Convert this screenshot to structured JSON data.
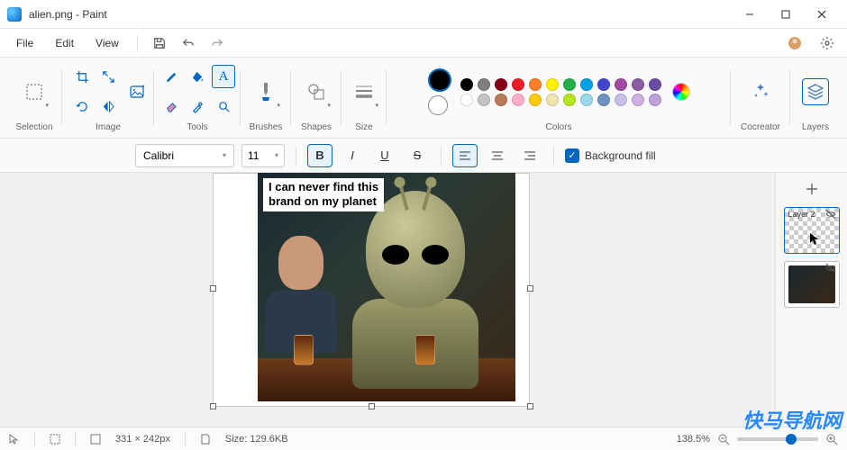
{
  "titlebar": {
    "title": "alien.png - Paint"
  },
  "menubar": {
    "file": "File",
    "edit": "Edit",
    "view": "View"
  },
  "ribbon": {
    "selection_label": "Selection",
    "image_label": "Image",
    "tools_label": "Tools",
    "brushes_label": "Brushes",
    "shapes_label": "Shapes",
    "size_label": "Size",
    "colors_label": "Colors",
    "cocreator_label": "Cocreator",
    "layers_label": "Layers",
    "palette_row1": [
      "#000000",
      "#7f7f7f",
      "#880015",
      "#ed1c24",
      "#ff7f27",
      "#fff200",
      "#22b14c",
      "#00a2e8",
      "#3f48cc",
      "#a349a4",
      "#8a5ca4",
      "#6a4ca4"
    ],
    "palette_row2": [
      "#ffffff",
      "#c3c3c3",
      "#b97a57",
      "#ffaec9",
      "#ffc90e",
      "#efe4b0",
      "#b5e61d",
      "#99d9ea",
      "#7092be",
      "#c8bfe7",
      "#d0b0e0",
      "#bfa0d8"
    ],
    "primary_color": "#000000",
    "secondary_color": "#ffffff"
  },
  "text_toolbar": {
    "font": "Calibri",
    "size": "11",
    "bg_fill_label": "Background fill",
    "bg_fill_checked": true
  },
  "canvas": {
    "text_line1": "I can never find this",
    "text_line2": "brand on my planet"
  },
  "layers": {
    "items": [
      {
        "name": "Layer 2",
        "active": true,
        "type": "checker"
      },
      {
        "name": "",
        "active": false,
        "type": "image"
      }
    ]
  },
  "statusbar": {
    "dimensions": "331 × 242px",
    "size_label": "Size: 129.6KB",
    "zoom": "138.5%"
  },
  "watermark": "快马导航网"
}
